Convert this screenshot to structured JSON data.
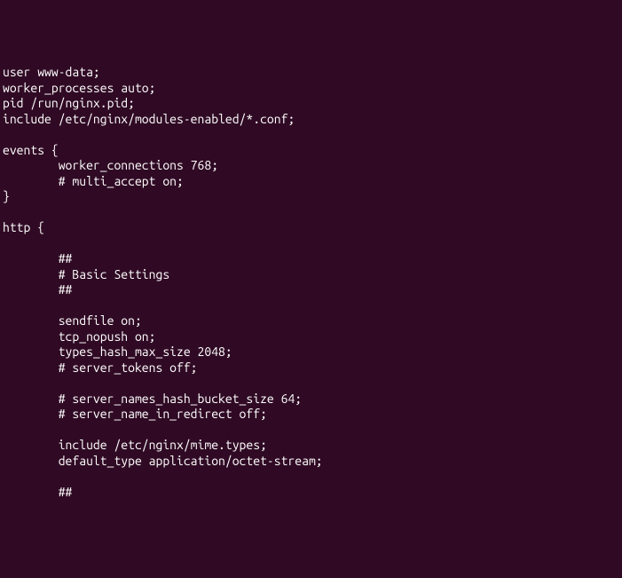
{
  "lines": [
    "user www-data;",
    "worker_processes auto;",
    "pid /run/nginx.pid;",
    "include /etc/nginx/modules-enabled/*.conf;",
    "",
    "events {",
    "        worker_connections 768;",
    "        # multi_accept on;",
    "}",
    "",
    "http {",
    "",
    "        ##",
    "        # Basic Settings",
    "        ##",
    "",
    "        sendfile on;",
    "        tcp_nopush on;",
    "        types_hash_max_size 2048;",
    "        # server_tokens off;",
    "",
    "        # server_names_hash_bucket_size 64;",
    "        # server_name_in_redirect off;",
    "",
    "        include /etc/nginx/mime.types;",
    "        default_type application/octet-stream;",
    "",
    "        ##"
  ]
}
